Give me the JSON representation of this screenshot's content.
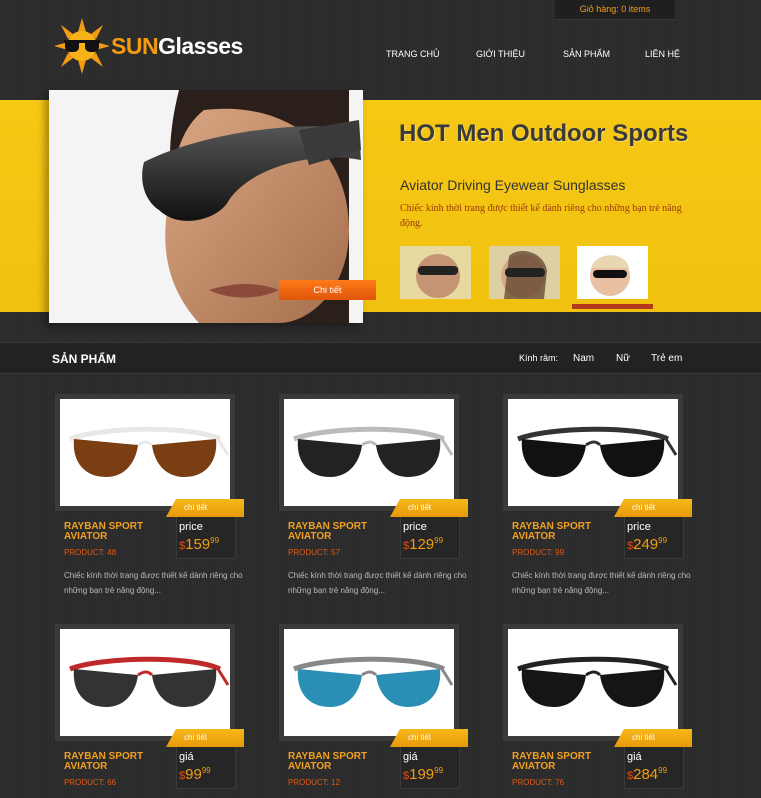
{
  "header": {
    "cart": "Giỏ hàng:   0 items",
    "logo_sun": "SUN",
    "logo_glasses": "Glasses",
    "nav": [
      "TRANG CHỦ",
      "GIỚI THIỆU",
      "SẢN PHẨM",
      "LIÊN HỆ"
    ]
  },
  "hero": {
    "title": "HOT Men Outdoor Sports",
    "subtitle": "Aviator Driving Eyewear Sunglasses",
    "description": "Chiếc kính thời trang được thiết kế dành riêng cho những bạn trẻ năng động.",
    "button": "Chi tiết"
  },
  "section": {
    "title": "SẢN PHẨM",
    "filter_label": "Kính râm:",
    "filters": [
      "Nam",
      "Nữ",
      "Trẻ em"
    ]
  },
  "products": [
    {
      "name": "RAYBAN SPORT AVIATOR",
      "code": "PRODUCT: 48",
      "price_label": "price",
      "currency": "$",
      "price_int": "159",
      "price_cents": "99",
      "tag": "chi tiết",
      "desc": "Chiếc kính thời trang được thiết kế dành riêng cho những bạn trẻ năng động..."
    },
    {
      "name": "RAYBAN SPORT AVIATOR",
      "code": "PRODUCT: 57",
      "price_label": "price",
      "currency": "$",
      "price_int": "129",
      "price_cents": "99",
      "tag": "chi tiết",
      "desc": "Chiếc kính thời trang được thiết kế dành riêng cho những bạn trẻ năng động..."
    },
    {
      "name": "RAYBAN SPORT AVIATOR",
      "code": "PRODUCT: 99",
      "price_label": "price",
      "currency": "$",
      "price_int": "249",
      "price_cents": "99",
      "tag": "chi tiết",
      "desc": "Chiếc kính thời trang được thiết kế dành riêng cho những bạn trẻ năng động..."
    },
    {
      "name": "RAYBAN SPORT AVIATOR",
      "code": "PRODUCT: 66",
      "price_label": "giá",
      "currency": "$",
      "price_int": "99",
      "price_cents": "99",
      "tag": "chi tiết",
      "desc": ""
    },
    {
      "name": "RAYBAN SPORT AVIATOR",
      "code": "PRODUCT: 12",
      "price_label": "giá",
      "currency": "$",
      "price_int": "199",
      "price_cents": "99",
      "tag": "chi tiết",
      "desc": ""
    },
    {
      "name": "RAYBAN SPORT AVIATOR",
      "code": "PRODUCT: 76",
      "price_label": "giá",
      "currency": "$",
      "price_int": "284",
      "price_cents": "99",
      "tag": "chi tiết",
      "desc": ""
    }
  ],
  "colors": {
    "accent": "#f39c12",
    "hero_bg": "#f6c814",
    "button": "#ff7a1a"
  }
}
